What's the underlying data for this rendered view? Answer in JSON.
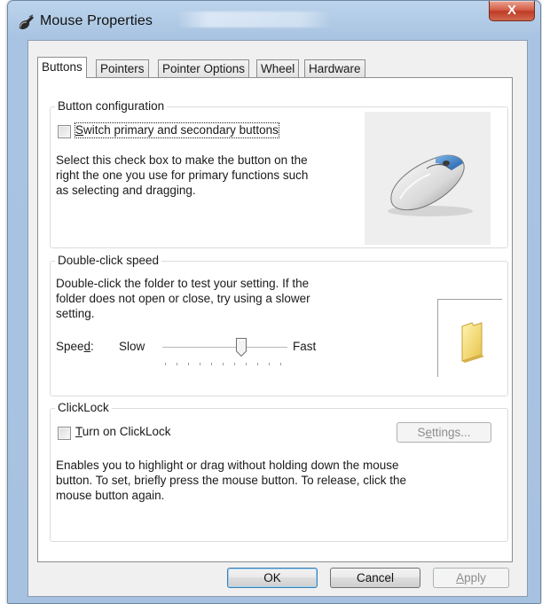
{
  "window": {
    "title": "Mouse Properties",
    "close_glyph": "X"
  },
  "tabs": [
    {
      "label": "Buttons",
      "active": true
    },
    {
      "label": "Pointers",
      "active": false
    },
    {
      "label": "Pointer Options",
      "active": false
    },
    {
      "label": "Wheel",
      "active": false
    },
    {
      "label": "Hardware",
      "active": false
    }
  ],
  "button_configuration": {
    "title": "Button configuration",
    "checkbox_label_mnemonic": "S",
    "checkbox_label_rest": "witch primary and secondary buttons",
    "checked": false,
    "description_lines": [
      "Select this check box to make the button on the",
      "right the one you use for primary functions such",
      "as selecting and dragging."
    ],
    "image_icon": "mouse-icon"
  },
  "double_click": {
    "title": "Double-click speed",
    "description_lines": [
      "Double-click the folder to test your setting. If the",
      "folder does not open or close, try using a slower",
      "setting."
    ],
    "speed_label_pre": "Spee",
    "speed_label_mnemonic": "d",
    "speed_label_post": ":",
    "slow_label": "Slow",
    "fast_label": "Fast",
    "speed_level": 0.6,
    "test_icon": "folder-icon"
  },
  "clicklock": {
    "title": "ClickLock",
    "checkbox_label_mnemonic": "T",
    "checkbox_label_rest": "urn on ClickLock",
    "checked": false,
    "settings_pre": "S",
    "settings_mnemonic": "e",
    "settings_post": "ttings...",
    "settings_enabled": false,
    "description_lines": [
      "Enables you to highlight or drag without holding down the mouse",
      "button. To set, briefly press the mouse button. To release, click the",
      "mouse button again."
    ]
  },
  "footer": {
    "ok_label": "OK",
    "cancel_label": "Cancel",
    "apply_mnemonic": "A",
    "apply_rest": "pply",
    "apply_enabled": false
  }
}
